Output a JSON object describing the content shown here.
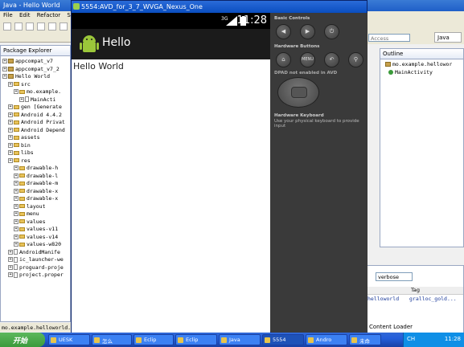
{
  "eclipse": {
    "title": "Java - Hello World",
    "menu": [
      "File",
      "Edit",
      "Refactor",
      "Se"
    ],
    "quick_access": "Access",
    "perspective_label": "Java"
  },
  "package_explorer": {
    "title": "Package Explorer",
    "items": [
      {
        "label": "appcompat_v7",
        "indent": 0,
        "icon": "project-icon"
      },
      {
        "label": "appcompat_v7_2",
        "indent": 0,
        "icon": "project-icon"
      },
      {
        "label": "Hello World",
        "indent": 0,
        "icon": "project-icon"
      },
      {
        "label": "src",
        "indent": 1,
        "icon": "folder-icon"
      },
      {
        "label": "mo.example.",
        "indent": 2,
        "icon": "package-icon"
      },
      {
        "label": "MainActi",
        "indent": 3,
        "icon": "java-file-icon"
      },
      {
        "label": "gen [Generate",
        "indent": 1,
        "icon": "folder-icon"
      },
      {
        "label": "Android 4.4.2",
        "indent": 1,
        "icon": "library-icon"
      },
      {
        "label": "Android Privat",
        "indent": 1,
        "icon": "library-icon"
      },
      {
        "label": "Android Depend",
        "indent": 1,
        "icon": "library-icon"
      },
      {
        "label": "assets",
        "indent": 1,
        "icon": "folder-icon"
      },
      {
        "label": "bin",
        "indent": 1,
        "icon": "folder-icon"
      },
      {
        "label": "libs",
        "indent": 1,
        "icon": "folder-icon"
      },
      {
        "label": "res",
        "indent": 1,
        "icon": "folder-icon"
      },
      {
        "label": "drawable-h",
        "indent": 2,
        "icon": "folder-icon"
      },
      {
        "label": "drawable-l",
        "indent": 2,
        "icon": "folder-icon"
      },
      {
        "label": "drawable-m",
        "indent": 2,
        "icon": "folder-icon"
      },
      {
        "label": "drawable-x",
        "indent": 2,
        "icon": "folder-icon"
      },
      {
        "label": "drawable-x",
        "indent": 2,
        "icon": "folder-icon"
      },
      {
        "label": "layout",
        "indent": 2,
        "icon": "folder-icon"
      },
      {
        "label": "menu",
        "indent": 2,
        "icon": "folder-icon"
      },
      {
        "label": "values",
        "indent": 2,
        "icon": "folder-icon"
      },
      {
        "label": "values-v11",
        "indent": 2,
        "icon": "folder-icon"
      },
      {
        "label": "values-v14",
        "indent": 2,
        "icon": "folder-icon"
      },
      {
        "label": "values-w820",
        "indent": 2,
        "icon": "folder-icon"
      },
      {
        "label": "AndroidManife",
        "indent": 1,
        "icon": "xml-file-icon"
      },
      {
        "label": "ic_launcher-we",
        "indent": 1,
        "icon": "image-file-icon"
      },
      {
        "label": "proguard-proje",
        "indent": 1,
        "icon": "text-file-icon"
      },
      {
        "label": "project.proper",
        "indent": 1,
        "icon": "text-file-icon"
      }
    ]
  },
  "status_line": "mo.example.helloworld.Main",
  "outline": {
    "title": "Outline",
    "items": [
      {
        "label": "mo.example.hellowor",
        "indent": 0
      },
      {
        "label": "MainActivity",
        "indent": 1
      }
    ]
  },
  "logcat": {
    "filter": "verbose",
    "column": "Tag",
    "row_text": "helloworld",
    "row_tag": "gralloc_gold...",
    "footer": "Content Loader"
  },
  "avd": {
    "title": "5554:AVD_for_3_7_WVGA_Nexus_One",
    "status_time": "11:28",
    "network": "3G",
    "app_title": "Hello",
    "content_text": "Hello World",
    "basic_controls_label": "Basic Controls",
    "hardware_buttons_label": "Hardware Buttons",
    "dpad_label": "DPAD not enabled in AVD",
    "keyboard_label": "Hardware Keyboard",
    "keyboard_hint": "Use your physical keyboard to provide input",
    "menu_button_label": "MENU"
  },
  "taskbar": {
    "start_label": "开始",
    "tasks": [
      "UESK",
      "怎么",
      "Eclip",
      "Eclip",
      "Java",
      "5554",
      "Andro",
      "未命"
    ],
    "tray_ime": "CH",
    "time": "11:28"
  }
}
